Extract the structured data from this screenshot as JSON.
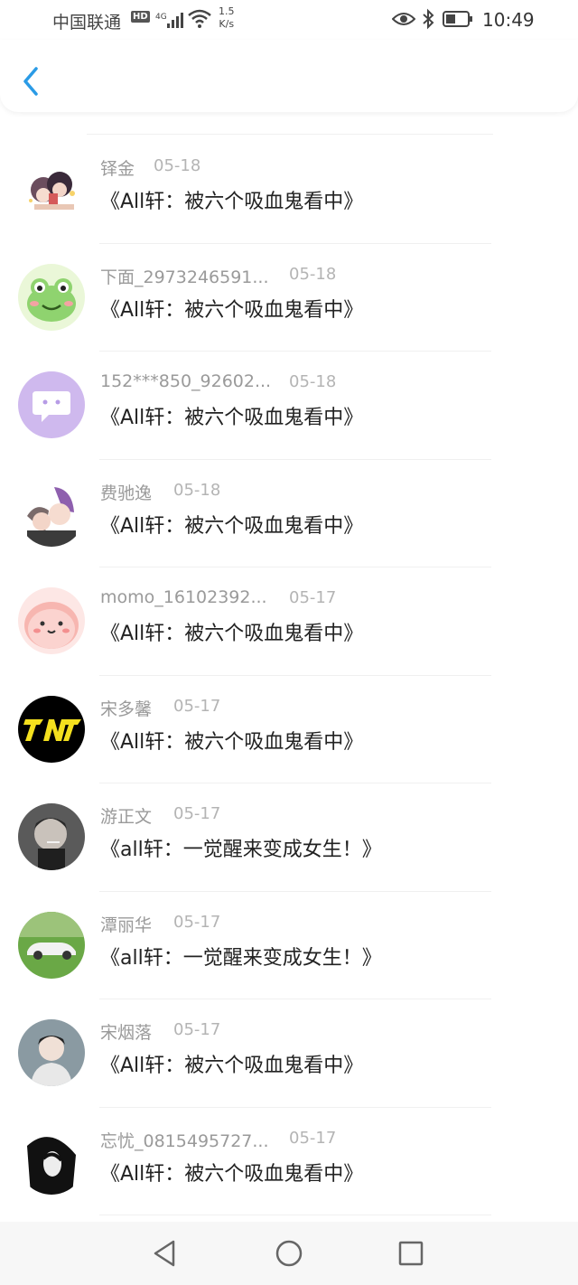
{
  "status_bar": {
    "carrier": "中国联通",
    "hd": "HD",
    "network": "4G",
    "speed_value": "1.5",
    "speed_unit": "K/s",
    "time": "10:49"
  },
  "colors": {
    "accent": "#2a9be6",
    "name": "#9a9a9a",
    "date": "#b4b4b4",
    "title": "#222222"
  },
  "list": [
    {
      "name": "铎金",
      "date": "05-18",
      "title": "《All轩：被六个吸血鬼看中》",
      "avatar": "anime-couple"
    },
    {
      "name": "下面_2973246591...",
      "date": "05-18",
      "title": "《All轩：被六个吸血鬼看中》",
      "avatar": "frog"
    },
    {
      "name": "152***850_92602...",
      "date": "05-18",
      "title": "《All轩：被六个吸血鬼看中》",
      "avatar": "chat-bubble"
    },
    {
      "name": "费驰逸",
      "date": "05-18",
      "title": "《All轩：被六个吸血鬼看中》",
      "avatar": "anime-duo"
    },
    {
      "name": "momo_16102392...",
      "date": "05-17",
      "title": "《All轩：被六个吸血鬼看中》",
      "avatar": "pink-blob"
    },
    {
      "name": "宋多馨",
      "date": "05-17",
      "title": "《All轩：被六个吸血鬼看中》",
      "avatar": "tnt-logo"
    },
    {
      "name": "游正文",
      "date": "05-17",
      "title": "《all轩：一觉醒来变成女生！》",
      "avatar": "man-photo"
    },
    {
      "name": "潭丽华",
      "date": "05-17",
      "title": "《all轩：一觉醒来变成女生！》",
      "avatar": "white-car"
    },
    {
      "name": "宋烟落",
      "date": "05-17",
      "title": "《All轩：被六个吸血鬼看中》",
      "avatar": "boy-photo"
    },
    {
      "name": "忘忧_0815495727...",
      "date": "05-17",
      "title": "《All轩：被六个吸血鬼看中》",
      "avatar": "dark-portrait"
    }
  ]
}
